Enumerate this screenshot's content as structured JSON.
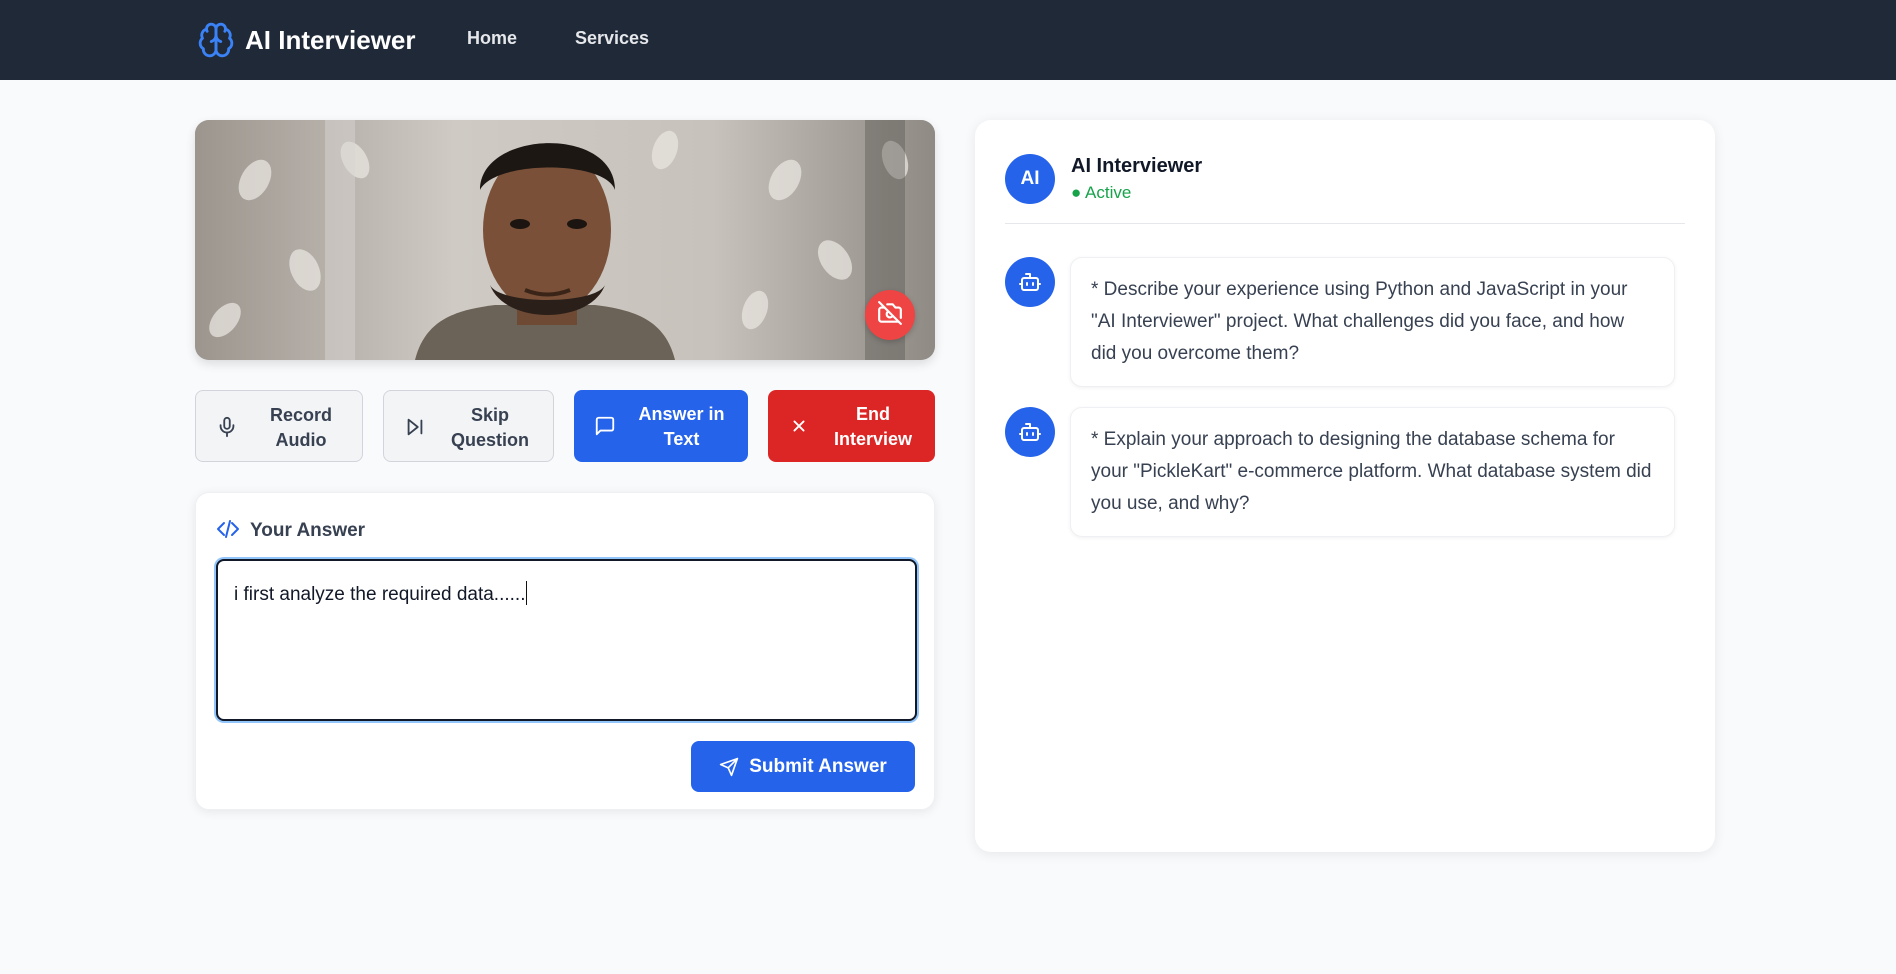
{
  "navbar": {
    "brand": "AI Interviewer",
    "links": [
      "Home",
      "Services"
    ]
  },
  "video": {
    "camera_toggle_icon": "camera-off-icon"
  },
  "controls": {
    "record": "Record Audio",
    "skip": "Skip Question",
    "text": "Answer in Text",
    "end": "End Interview"
  },
  "answer": {
    "title": "Your Answer",
    "value": "i first analyze the required data......",
    "submit": "Submit Answer"
  },
  "chat": {
    "avatar": "AI",
    "name": "AI Interviewer",
    "status": "● Active",
    "messages": [
      "* Describe your experience using Python and JavaScript in your \"AI Interviewer\" project. What challenges did you face, and how did you overcome them?",
      "* Explain your approach to designing the database schema for your \"PickleKart\" e-commerce platform. What database system did you use, and why?"
    ]
  },
  "colors": {
    "navbar": "#1f2937",
    "primary": "#2563eb",
    "danger": "#dc2626",
    "active": "#16a34a"
  }
}
